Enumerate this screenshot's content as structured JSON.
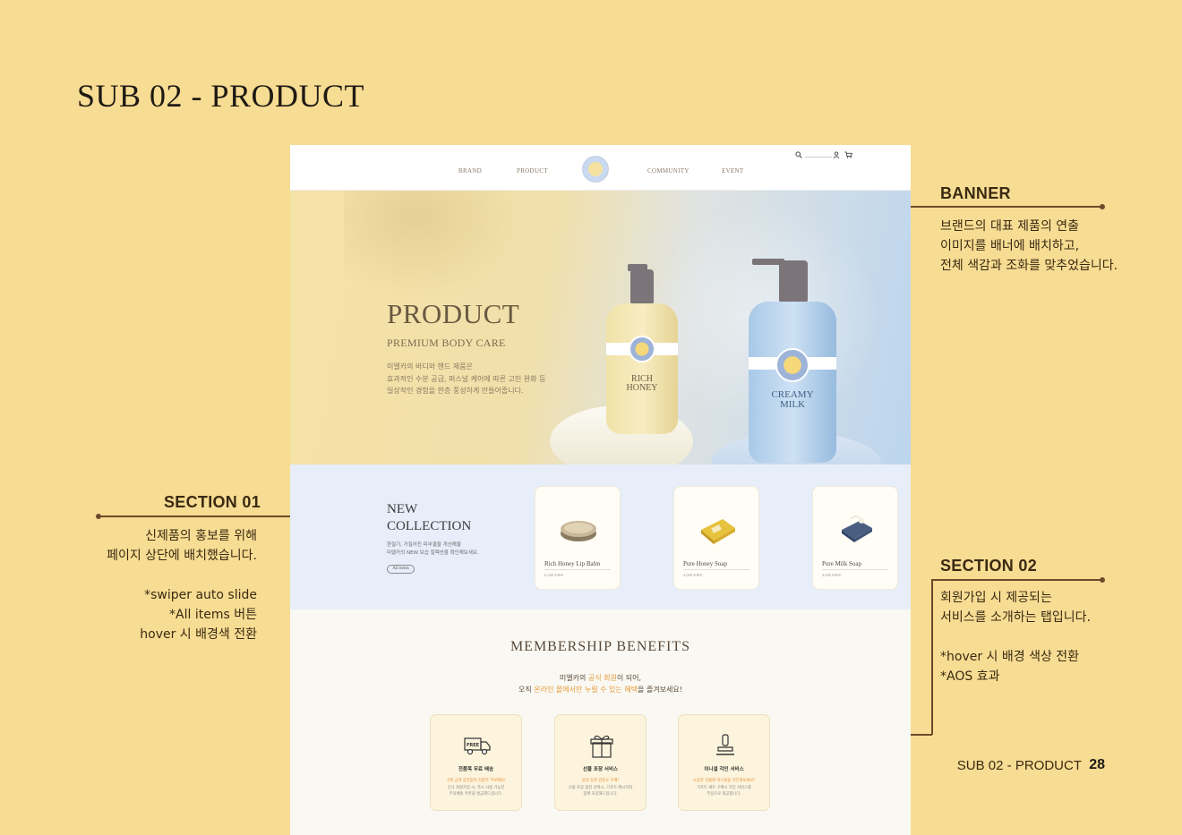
{
  "page": {
    "title": "SUB 02 - PRODUCT",
    "footer_label": "SUB 02 - PRODUCT",
    "page_number": "28"
  },
  "annotations": {
    "banner": {
      "title": "BANNER",
      "text": "브랜드의 대표 제품의 연출\n이미지를 배너에 배치하고,\n전체 색감과 조화를 맞추었습니다."
    },
    "section01": {
      "title": "SECTION 01",
      "text": "신제품의 홍보를 위해\n페이지 상단에 배치했습니다.\n\n*swiper auto slide\n*All items 버튼\nhover 시 배경색 전환"
    },
    "section02": {
      "title": "SECTION 02",
      "text": "회원가입 시 제공되는\n서비스를 소개하는 탭입니다.\n\n*hover 시 배경 색상 전환\n*AOS 효과"
    }
  },
  "nav": {
    "links": [
      "BRAND",
      "PRODUCT",
      "COMMUNITY",
      "EVENT"
    ],
    "logo_icon": "mielka-logo",
    "icons": [
      "search-icon",
      "user-icon",
      "cart-icon"
    ]
  },
  "banner": {
    "title": "PRODUCT",
    "subtitle": "PREMIUM BODY CARE",
    "description": "미엘카의 바디와 핸드 제품은\n효과적인 수분 공급, 퍼스널 케어에 따른 고민 완화 등\n일상적인 경험을 한층 풍성하게 만들어줍니다.",
    "bottle1": "RICH\nHONEY",
    "bottle2": "CREAMY\nMILK"
  },
  "new_collection": {
    "title": "NEW\nCOLLECTION",
    "description": "환절기, 거칠어진 피부결을 개선해줄\n미엘카의 NEW 보습 컬렉션을 확인해보세요.",
    "button": "All items",
    "products": [
      {
        "name": "Rich Honey Lip Balm",
        "price": "6,500 KRW"
      },
      {
        "name": "Pure Honey Soap",
        "price": "4,000 KRW"
      },
      {
        "name": "Pure Milk Soap",
        "price": "4,000 KRW"
      }
    ]
  },
  "membership": {
    "title": "MEMBERSHIP BENEFITS",
    "line1_pre": "미엘카의 ",
    "line1_hl": "공식 회원",
    "line1_post": "이 되어,",
    "line2_pre": "오직 ",
    "line2_hl": "온라인 몰에서만 누릴 수 있는 혜택",
    "line2_post": "을 즐겨보세요!",
    "benefits": [
      {
        "icon": "free-delivery-truck-icon",
        "badge": "FREE",
        "name": "전품목 무료 배송",
        "highlight": "구매 금액 상관없이 전품목 무료배송!",
        "desc": "신규 회원가입 시, 즉시 사용 가능한\n무료배송 쿠폰을 발급해드립니다."
      },
      {
        "icon": "gift-box-icon",
        "name": "선물 포장 서비스",
        "highlight": "정성 듬뿍 감동도 두배!",
        "desc": "선물 포장 옵션 선택시, 기프트 메시지와\n함께 포장해드립니다."
      },
      {
        "icon": "stamp-icon",
        "name": "이니셜 각인 서비스",
        "highlight": "소중한 선물에 이니셜을 각인해보세요!",
        "desc": "기프트 세트 구매시 각인 서비스를\n무상으로 제공합니다."
      }
    ]
  },
  "colors": {
    "background": "#f7dc93",
    "accent": "#e89a3a",
    "text": "#3a2a12"
  }
}
